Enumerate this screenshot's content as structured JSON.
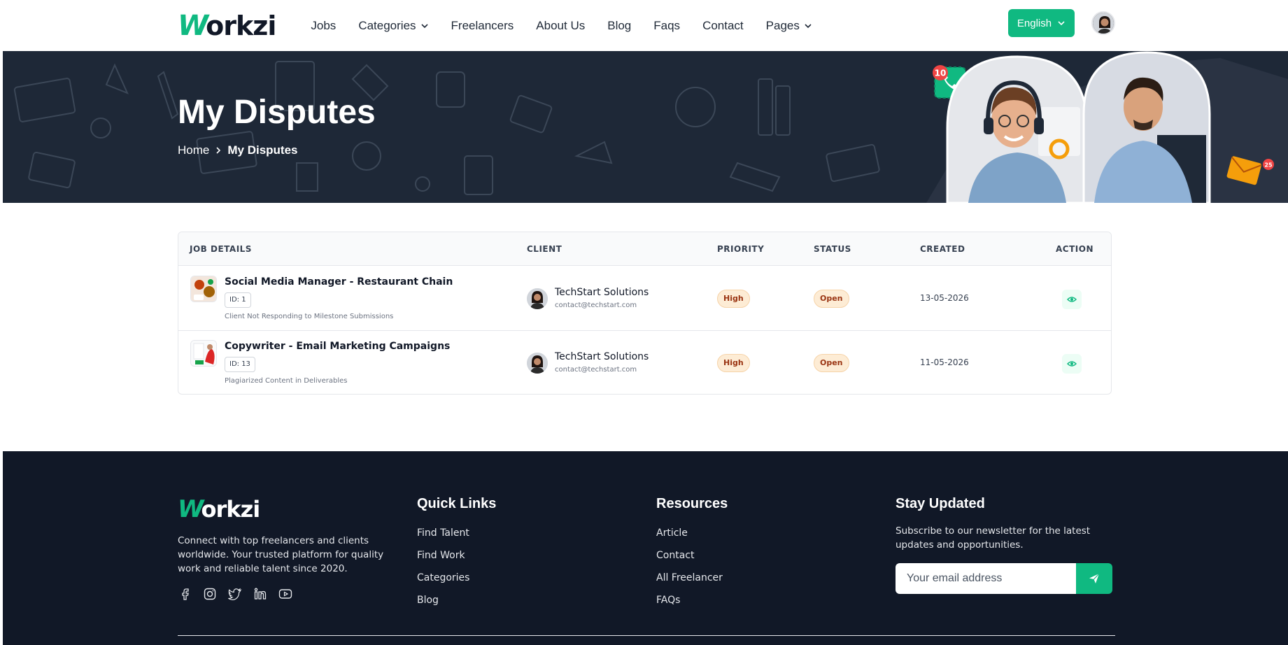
{
  "brand": {
    "logo_w": "W",
    "logo_rest": "orkzi"
  },
  "nav": {
    "items": [
      {
        "label": "Jobs"
      },
      {
        "label": "Categories"
      },
      {
        "label": "Freelancers"
      },
      {
        "label": "About Us"
      },
      {
        "label": "Blog"
      },
      {
        "label": "Faqs"
      },
      {
        "label": "Contact"
      },
      {
        "label": "Pages"
      }
    ],
    "language": "English"
  },
  "hero": {
    "title": "My Disputes",
    "breadcrumb": {
      "home": "Home",
      "current": "My Disputes"
    },
    "call_badge": "10",
    "mail_badge": "25"
  },
  "table": {
    "headers": {
      "job": "JOB DETAILS",
      "client": "CLIENT",
      "priority": "PRIORITY",
      "status": "STATUS",
      "created": "CREATED",
      "action": "ACTION"
    },
    "rows": [
      {
        "title": "Social Media Manager - Restaurant Chain",
        "id": "ID: 1",
        "reason": "Client Not Responding to Milestone Submissions",
        "client_name": "TechStart Solutions",
        "client_email": "contact@techstart.com",
        "priority": "High",
        "status": "Open",
        "created": "13-05-2026"
      },
      {
        "title": "Copywriter - Email Marketing Campaigns",
        "id": "ID: 13",
        "reason": "Plagiarized Content in Deliverables",
        "client_name": "TechStart Solutions",
        "client_email": "contact@techstart.com",
        "priority": "High",
        "status": "Open",
        "created": "11-05-2026"
      }
    ]
  },
  "footer": {
    "about": "Connect with top freelancers and clients worldwide. Your trusted platform for quality work and reliable talent since 2020.",
    "quick_links": {
      "heading": "Quick Links",
      "items": [
        "Find Talent",
        "Find Work",
        "Categories",
        "Blog"
      ]
    },
    "resources": {
      "heading": "Resources",
      "items": [
        "Article",
        "Contact",
        "All Freelancer",
        "FAQs"
      ]
    },
    "newsletter": {
      "heading": "Stay Updated",
      "text": "Subscribe to our newsletter for the latest updates and opportunities.",
      "placeholder": "Your email address"
    },
    "socials": [
      "facebook-icon",
      "instagram-icon",
      "twitter-icon",
      "linkedin-icon",
      "youtube-icon"
    ]
  },
  "colors": {
    "accent": "#10b981",
    "hero_bg": "#1e2837",
    "footer_bg": "#111827",
    "badge_bg": "#fdecd5"
  }
}
